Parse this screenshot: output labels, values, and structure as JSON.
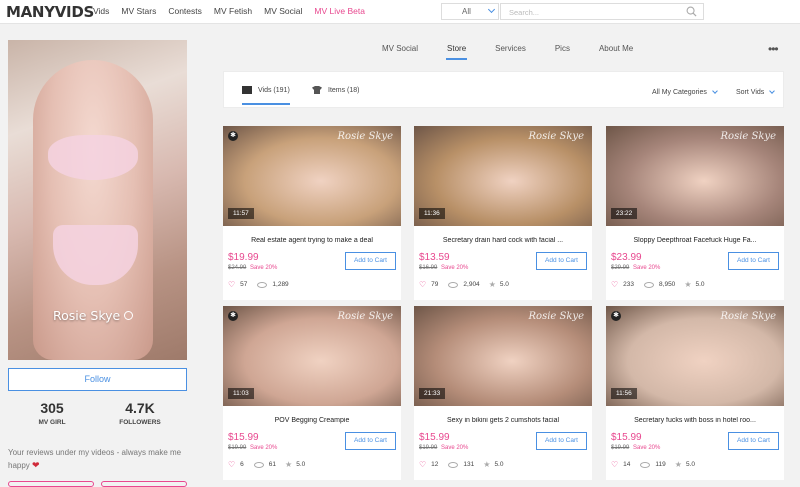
{
  "header": {
    "logo": "MANYVIDS",
    "nav": [
      "Vids",
      "MV Stars",
      "Contests",
      "MV Fetish",
      "MV Social",
      "MV Live Beta"
    ],
    "filter_value": "All",
    "search_placeholder": "Search..."
  },
  "profile": {
    "name": "Rosie Skye",
    "follow_label": "Follow",
    "mv_girl_count": "305",
    "mv_girl_label": "MV GIRL",
    "followers_count": "4.7K",
    "followers_label": "FOLLOWERS",
    "bio": "Your reviews under my videos - always make me happy"
  },
  "tabs": [
    "MV Social",
    "Store",
    "Services",
    "Pics",
    "About Me"
  ],
  "active_tab": "Store",
  "subbar": {
    "vids_label": "Vids (191)",
    "items_label": "Items (18)",
    "categories_label": "All My Categories",
    "sort_label": "Sort Vids"
  },
  "cart_label": "Add to Cart",
  "watermark": "Rosie Skye",
  "videos": [
    {
      "duration": "11:57",
      "title": "Real estate agent trying to make a deal",
      "price": "$19.99",
      "old_price": "$24.99",
      "discount": "Save 20%",
      "likes": "57",
      "views": "1,289",
      "rating": "",
      "thumb_color": "#c8a17a",
      "badge": true
    },
    {
      "duration": "11:36",
      "title": "Secretary drain hard cock with facial ...",
      "price": "$13.59",
      "old_price": "$16.99",
      "discount": "Save 20%",
      "likes": "79",
      "views": "2,904",
      "rating": "5.0",
      "thumb_color": "#b89067",
      "badge": false
    },
    {
      "duration": "23:22",
      "title": "Sloppy Deepthroat Facefuck Huge Fa...",
      "price": "$23.99",
      "old_price": "$29.99",
      "discount": "Save 20%",
      "likes": "233",
      "views": "8,950",
      "rating": "5.0",
      "thumb_color": "#a6857a",
      "badge": false
    },
    {
      "duration": "11:03",
      "title": "POV Begging Creampie",
      "price": "$15.99",
      "old_price": "$19.99",
      "discount": "Save 20%",
      "likes": "6",
      "views": "61",
      "rating": "5.0",
      "thumb_color": "#cfa694",
      "badge": true
    },
    {
      "duration": "21:33",
      "title": "Sexy in bikini gets 2 cumshots facial",
      "price": "$15.99",
      "old_price": "$19.99",
      "discount": "Save 20%",
      "likes": "12",
      "views": "131",
      "rating": "5.0",
      "thumb_color": "#b58d79",
      "badge": false
    },
    {
      "duration": "11:56",
      "title": "Secretary fucks with boss in hotel roo...",
      "price": "$15.99",
      "old_price": "$19.99",
      "discount": "Save 20%",
      "likes": "14",
      "views": "119",
      "rating": "5.0",
      "thumb_color": "#d3b8a8",
      "badge": true
    }
  ],
  "colors": {
    "accent": "#4a90e2",
    "pink": "#e8488f"
  }
}
